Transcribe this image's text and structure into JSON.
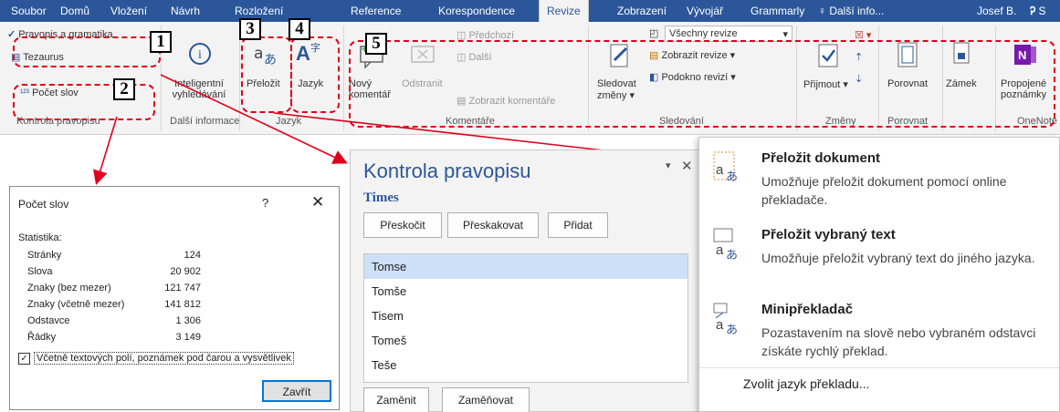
{
  "tabs": [
    "Soubor",
    "Domů",
    "Vložení",
    "Návrh",
    "Rozložení",
    "Reference",
    "Korespondence",
    "Revize",
    "Zobrazení",
    "Vývojář",
    "Grammarly"
  ],
  "active_tab": "Revize",
  "tell_me": "Další info...",
  "user": "Josef B.",
  "share_label": "S",
  "colors": {
    "accent": "#2b579a",
    "ribbon": "#f3f3f3",
    "highlight": "#e0001a",
    "selection": "#cde0f7"
  },
  "ribbon": {
    "spelling_grammar": "Pravopis a gramatika",
    "thesaurus": "Tezaurus",
    "word_count": "Počet slov",
    "group_proofing": "Kontrola pravopisu",
    "smart_lookup_l1": "Inteligentní",
    "smart_lookup_l2": "vyhledávání",
    "group_insights": "Další informace",
    "translate": "Přeložit",
    "language": "Jazyk",
    "group_language": "Jazyk",
    "new_comment_l1": "Nový",
    "new_comment_l2": "komentář",
    "delete": "Odstranit",
    "previous": "Předchozí",
    "next": "Další",
    "show_comments": "Zobrazit komentáře",
    "group_comments": "Komentáře",
    "track_changes_l1": "Sledovat",
    "track_changes_l2": "změny",
    "all_markup": "Všechny revize",
    "show_markup": "Zobrazit revize",
    "reviewing_pane": "Podokno revizí",
    "group_tracking": "Sledování",
    "accept": "Přijmout",
    "group_changes": "Změny",
    "compare": "Porovnat",
    "group_compare": "Porovnat",
    "protect": "Zámek",
    "linked_notes_l1": "Propojené",
    "linked_notes_l2": "poznámky",
    "group_onenote": "OneNote"
  },
  "markers": [
    "1",
    "2",
    "3",
    "4",
    "5"
  ],
  "word_count_dialog": {
    "title": "Počet slov",
    "help": "?",
    "close": "✕",
    "section": "Statistika:",
    "rows": [
      {
        "label": "Stránky",
        "value": "124"
      },
      {
        "label": "Slova",
        "value": "20 902"
      },
      {
        "label": "Znaky (bez mezer)",
        "value": "121 747"
      },
      {
        "label": "Znaky (včetně mezer)",
        "value": "141 812"
      },
      {
        "label": "Odstavce",
        "value": "1 306"
      },
      {
        "label": "Řádky",
        "value": "3 149"
      }
    ],
    "checkbox_label": "Včetně textových polí, poznámek pod čarou a vysvětlivek",
    "checkbox_checked": true,
    "close_button": "Zavřít"
  },
  "spelling_pane": {
    "title": "Kontrola pravopisu",
    "misspelled_word": "Times",
    "skip": "Přeskočit",
    "skip_all": "Přeskakovat",
    "add": "Přidat",
    "suggestions": [
      "Tomse",
      "Tomše",
      "Tisem",
      "Tomeš",
      "Teše"
    ],
    "selected_index": 0,
    "change": "Zaměnit",
    "change_all": "Zaměňovat",
    "menu": "▾",
    "close": "✕"
  },
  "translate_menu": {
    "items": [
      {
        "title": "Přeložit dokument",
        "desc": "Umožňuje přeložit dokument pomocí online překladače."
      },
      {
        "title": "Přeložit vybraný text",
        "desc": "Umožňuje přeložit vybraný text do jiného jazyka."
      },
      {
        "title": "Minipřekladač",
        "desc": "Pozastavením na slově nebo vybraném odstavci získáte rychlý překlad."
      }
    ],
    "footer": "Zvolit jazyk překladu..."
  }
}
